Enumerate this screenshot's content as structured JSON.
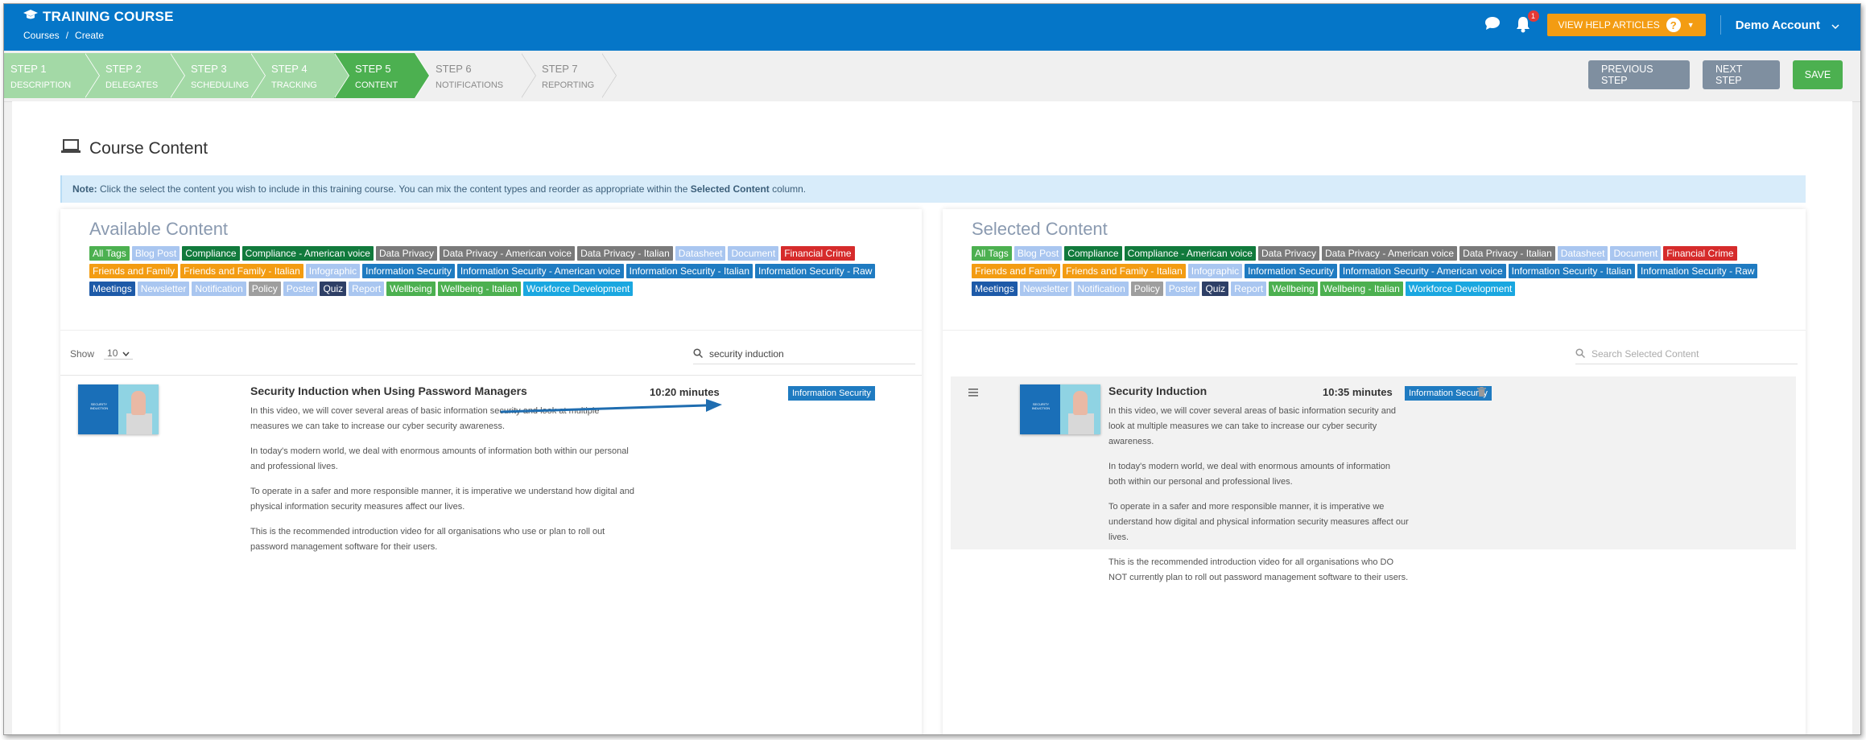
{
  "header": {
    "title": "TRAINING COURSE",
    "breadcrumbs": [
      "Courses",
      "Create"
    ],
    "breadcrumb_sep": "/",
    "help_label": "VIEW HELP ARTICLES",
    "help_icon": "?",
    "notification_count": "1",
    "account_label": "Demo Account"
  },
  "steps": [
    {
      "num": "STEP 1",
      "name": "DESCRIPTION",
      "state": "done"
    },
    {
      "num": "STEP 2",
      "name": "DELEGATES",
      "state": "done"
    },
    {
      "num": "STEP 3",
      "name": "SCHEDULING",
      "state": "done"
    },
    {
      "num": "STEP 4",
      "name": "TRACKING",
      "state": "done"
    },
    {
      "num": "STEP 5",
      "name": "CONTENT",
      "state": "active"
    },
    {
      "num": "STEP 6",
      "name": "NOTIFICATIONS",
      "state": "todo"
    },
    {
      "num": "STEP 7",
      "name": "REPORTING",
      "state": "todo"
    }
  ],
  "actions": {
    "previous": "PREVIOUS STEP",
    "next": "NEXT STEP",
    "save": "SAVE"
  },
  "page": {
    "title": "Course Content",
    "note_label": "Note:",
    "note_text": " Click the select the content you wish to include in this training course. You can mix the content types and reorder as appropriate within the ",
    "note_bold": "Selected Content",
    "note_end": " column."
  },
  "tags": [
    {
      "label": "All Tags",
      "color": "#4cb050"
    },
    {
      "label": "Blog Post",
      "color": "#a9c6f0"
    },
    {
      "label": "Compliance",
      "color": "#117a3c"
    },
    {
      "label": "Compliance - American voice",
      "color": "#117a3c"
    },
    {
      "label": "Data Privacy",
      "color": "#7a7a7a"
    },
    {
      "label": "Data Privacy - American voice",
      "color": "#7a7a7a"
    },
    {
      "label": "Data Privacy - Italian",
      "color": "#7a7a7a"
    },
    {
      "label": "Datasheet",
      "color": "#a9c6f0"
    },
    {
      "label": "Document",
      "color": "#a9c6f0"
    },
    {
      "label": "Financial Crime",
      "color": "#d62b2b"
    },
    {
      "label": "Friends and Family",
      "color": "#f39c12"
    },
    {
      "label": "Friends and Family - Italian",
      "color": "#f39c12"
    },
    {
      "label": "Infographic",
      "color": "#a9c6f0"
    },
    {
      "label": "Information Security",
      "color": "#1f7bc1"
    },
    {
      "label": "Information Security - American voice",
      "color": "#1f7bc1"
    },
    {
      "label": "Information Security - Italian",
      "color": "#1f7bc1"
    },
    {
      "label": "Information Security - Raw",
      "color": "#1f7bc1"
    },
    {
      "label": "Meetings",
      "color": "#1d5aa8"
    },
    {
      "label": "Newsletter",
      "color": "#a9c6f0"
    },
    {
      "label": "Notification",
      "color": "#a9c6f0"
    },
    {
      "label": "Policy",
      "color": "#9e9e9e"
    },
    {
      "label": "Poster",
      "color": "#a9c6f0"
    },
    {
      "label": "Quiz",
      "color": "#2e3f66"
    },
    {
      "label": "Report",
      "color": "#a9c6f0"
    },
    {
      "label": "Wellbeing",
      "color": "#4cb050"
    },
    {
      "label": "Wellbeing - Italian",
      "color": "#4cb050"
    },
    {
      "label": "Workforce Development",
      "color": "#1aa7e0"
    }
  ],
  "available": {
    "title": "Available Content",
    "show_label": "Show",
    "show_value": "10",
    "search_value": "security induction",
    "item": {
      "title": "Security Induction when Using Password Managers",
      "duration": "10:20 minutes",
      "tag": "Information Security",
      "thumb_text": "SECURITY INDUCTION",
      "paragraphs": [
        "In this video, we will cover several areas of basic information security and look at multiple measures we can take to increase our cyber security awareness.",
        "In today's modern world, we deal with enormous amounts of information both within our personal and professional lives.",
        "To operate in a safer and more responsible manner, it is imperative we understand how digital and physical information security measures affect our lives.",
        "This is the recommended introduction video for all organisations who use or plan to roll out password management software for their users."
      ]
    }
  },
  "selected": {
    "title": "Selected Content",
    "search_placeholder": "Search Selected Content",
    "item": {
      "title": "Security Induction",
      "duration": "10:35 minutes",
      "tag": "Information Security",
      "thumb_text": "SECURITY INDUCTION",
      "paragraphs": [
        "In this video, we will cover several areas of basic information security and look at multiple measures we can take to increase our cyber security awareness.",
        "In today's modern world, we deal with enormous amounts of information both within our personal and professional lives.",
        "To operate in a safer and more responsible manner, it is imperative we understand how digital and physical information security measures affect our lives.",
        "This is the recommended introduction video for all organisations who DO NOT currently plan to roll out password management software to their users."
      ]
    }
  },
  "colors": {
    "brand": "#0576c8",
    "accent": "#f39c12",
    "step_done": "#a3d9a6",
    "step_active": "#4cb050",
    "arrow": "#1f6db0"
  }
}
